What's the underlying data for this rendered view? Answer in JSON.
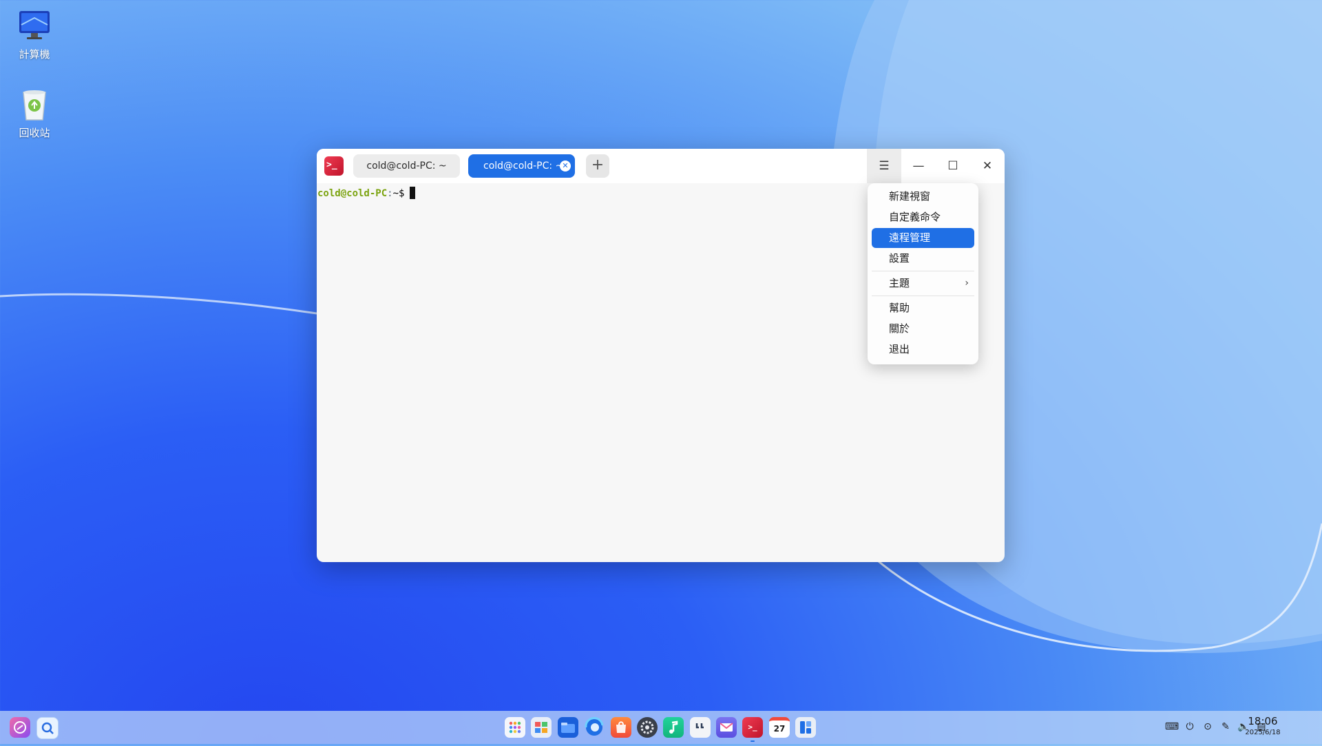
{
  "desktop": {
    "icons": [
      {
        "label": "計算機",
        "icon": "monitor-icon"
      },
      {
        "label": "回收站",
        "icon": "trash-icon"
      }
    ]
  },
  "window": {
    "app_icon": "terminal-icon",
    "tabs": [
      {
        "label": "cold@cold-PC: ~"
      },
      {
        "label": "cold@cold-PC: ~",
        "active": true
      }
    ],
    "new_tab_symbol": "+",
    "controls": {
      "menu": "☰",
      "minimize": "—",
      "maximize": "☐",
      "close": "✕"
    },
    "terminal": {
      "user": "cold@cold-PC",
      "sep": ":",
      "path": "~$"
    }
  },
  "menu": {
    "items": [
      "新建視窗",
      "自定義命令",
      "遠程管理",
      "設置",
      "主題",
      "幫助",
      "關於",
      "退出"
    ],
    "highlighted": "遠程管理",
    "submenu_arrow": "›"
  },
  "dock": {
    "left": [
      "launcher-icon",
      "search-icon"
    ],
    "apps": [
      "app-grid-icon",
      "multitask-icon",
      "file-manager-icon",
      "browser-icon",
      "app-store-icon",
      "settings-icon",
      "music-icon",
      "notes-icon",
      "mail-icon",
      "terminal-icon",
      "calendar-icon",
      "control-center-icon"
    ],
    "calendar_day": "27",
    "tray": [
      "keyboard-icon",
      "power-icon",
      "clock-icon",
      "pen-icon",
      "volume-icon",
      "storage-icon"
    ],
    "time": "18:06",
    "date": "2025/6/18"
  },
  "colors": {
    "accent": "#1f6fe5",
    "prompt_user": "#7ba30f",
    "terminal_icon": "#d9233c"
  }
}
